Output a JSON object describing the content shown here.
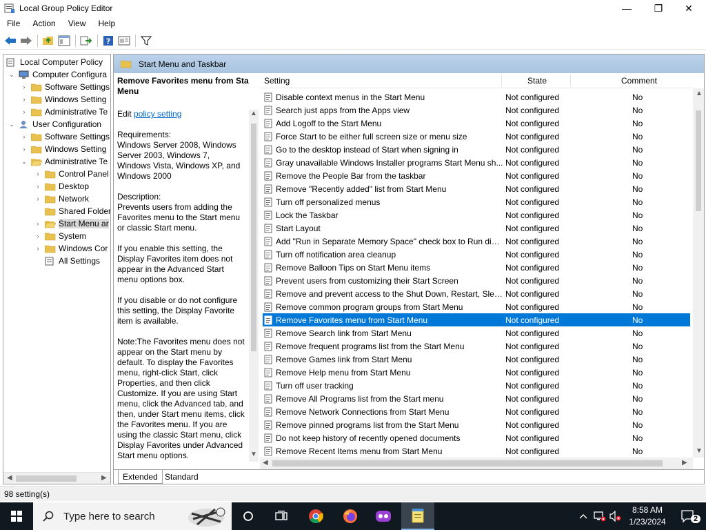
{
  "window": {
    "title": "Local Group Policy Editor",
    "minimize": "—",
    "maximize": "❐",
    "close": "✕"
  },
  "menu": [
    "File",
    "Action",
    "View",
    "Help"
  ],
  "tree": [
    {
      "label": "Local Computer Policy",
      "level": 0,
      "chev": ""
    },
    {
      "label": "Computer Configura",
      "level": 1,
      "chev": "⌄"
    },
    {
      "label": "Software Settings",
      "level": 2,
      "chev": "›"
    },
    {
      "label": "Windows Setting",
      "level": 2,
      "chev": "›"
    },
    {
      "label": "Administrative Te",
      "level": 2,
      "chev": "›"
    },
    {
      "label": "User Configuration",
      "level": 1,
      "chev": "⌄"
    },
    {
      "label": "Software Settings",
      "level": 2,
      "chev": "›"
    },
    {
      "label": "Windows Setting",
      "level": 2,
      "chev": "›"
    },
    {
      "label": "Administrative Te",
      "level": 2,
      "chev": "⌄"
    },
    {
      "label": "Control Panel",
      "level": 3,
      "chev": "›"
    },
    {
      "label": "Desktop",
      "level": 3,
      "chev": "›"
    },
    {
      "label": "Network",
      "level": 3,
      "chev": "›"
    },
    {
      "label": "Shared Folder",
      "level": 3,
      "chev": ""
    },
    {
      "label": "Start Menu ar",
      "level": 3,
      "chev": "›",
      "selected": true
    },
    {
      "label": "System",
      "level": 3,
      "chev": "›"
    },
    {
      "label": "Windows Cor",
      "level": 3,
      "chev": "›"
    },
    {
      "label": "All Settings",
      "level": 3,
      "chev": ""
    }
  ],
  "panel": {
    "header": "Start Menu and Taskbar",
    "desc_title": "Remove Favorites menu from Start Menu",
    "edit_prefix": "Edit ",
    "edit_link": "policy setting",
    "requirements": "Requirements:\nWindows Server 2008, Windows Server 2003, Windows 7, Windows Vista, Windows XP, and Windows 2000",
    "description": "Description:\nPrevents users from adding the Favorites menu to the Start menu or classic Start menu.",
    "para1": "If you enable this setting, the Display Favorites item does not appear in the Advanced Start menu options box.",
    "para2": "If you disable or do not configure this setting, the Display Favorite item is available.",
    "para3": "Note:The Favorites menu does not appear on the Start menu by default. To display the Favorites menu, right-click Start, click Properties, and then click Customize.  If you are using Start menu, click the Advanced tab, and then, under Start menu items, click the Favorites menu. If you are using the classic Start menu, click Display Favorites under Advanced Start menu options."
  },
  "columns": {
    "setting": "Setting",
    "state": "State",
    "comment": "Comment"
  },
  "rows": [
    {
      "setting": "Disable context menus in the Start Menu",
      "state": "Not configured",
      "comment": "No"
    },
    {
      "setting": "Search just apps from the Apps view",
      "state": "Not configured",
      "comment": "No"
    },
    {
      "setting": "Add Logoff to the Start Menu",
      "state": "Not configured",
      "comment": "No"
    },
    {
      "setting": "Force Start to be either full screen size or menu size",
      "state": "Not configured",
      "comment": "No"
    },
    {
      "setting": "Go to the desktop instead of Start when signing in",
      "state": "Not configured",
      "comment": "No"
    },
    {
      "setting": "Gray unavailable Windows Installer programs Start Menu sh...",
      "state": "Not configured",
      "comment": "No"
    },
    {
      "setting": "Remove the People Bar from the taskbar",
      "state": "Not configured",
      "comment": "No"
    },
    {
      "setting": "Remove \"Recently added\" list from Start Menu",
      "state": "Not configured",
      "comment": "No"
    },
    {
      "setting": "Turn off personalized menus",
      "state": "Not configured",
      "comment": "No"
    },
    {
      "setting": "Lock the Taskbar",
      "state": "Not configured",
      "comment": "No"
    },
    {
      "setting": "Start Layout",
      "state": "Not configured",
      "comment": "No"
    },
    {
      "setting": "Add \"Run in Separate Memory Space\" check box to Run dial...",
      "state": "Not configured",
      "comment": "No"
    },
    {
      "setting": "Turn off notification area cleanup",
      "state": "Not configured",
      "comment": "No"
    },
    {
      "setting": "Remove Balloon Tips on Start Menu items",
      "state": "Not configured",
      "comment": "No"
    },
    {
      "setting": "Prevent users from customizing their Start Screen",
      "state": "Not configured",
      "comment": "No"
    },
    {
      "setting": "Remove and prevent access to the Shut Down, Restart, Sleep...",
      "state": "Not configured",
      "comment": "No"
    },
    {
      "setting": "Remove common program groups from Start Menu",
      "state": "Not configured",
      "comment": "No"
    },
    {
      "setting": "Remove Favorites menu from Start Menu",
      "state": "Not configured",
      "comment": "No",
      "selected": true
    },
    {
      "setting": "Remove Search link from Start Menu",
      "state": "Not configured",
      "comment": "No"
    },
    {
      "setting": "Remove frequent programs list from the Start Menu",
      "state": "Not configured",
      "comment": "No"
    },
    {
      "setting": "Remove Games link from Start Menu",
      "state": "Not configured",
      "comment": "No"
    },
    {
      "setting": "Remove Help menu from Start Menu",
      "state": "Not configured",
      "comment": "No"
    },
    {
      "setting": "Turn off user tracking",
      "state": "Not configured",
      "comment": "No"
    },
    {
      "setting": "Remove All Programs list from the Start menu",
      "state": "Not configured",
      "comment": "No"
    },
    {
      "setting": "Remove Network Connections from Start Menu",
      "state": "Not configured",
      "comment": "No"
    },
    {
      "setting": "Remove pinned programs list from the Start Menu",
      "state": "Not configured",
      "comment": "No"
    },
    {
      "setting": "Do not keep history of recently opened documents",
      "state": "Not configured",
      "comment": "No"
    },
    {
      "setting": "Remove Recent Items menu from Start Menu",
      "state": "Not configured",
      "comment": "No"
    }
  ],
  "tabs": {
    "extended": "Extended",
    "standard": "Standard"
  },
  "status": "98 setting(s)",
  "taskbar": {
    "search_placeholder": "Type here to search",
    "time": "8:58 AM",
    "date": "1/23/2024",
    "notification_count": "2"
  },
  "colors": {
    "selection": "#0078d7",
    "header_gradient": "#bcd3ea",
    "taskbar": "#101820",
    "link": "#0066cc"
  }
}
